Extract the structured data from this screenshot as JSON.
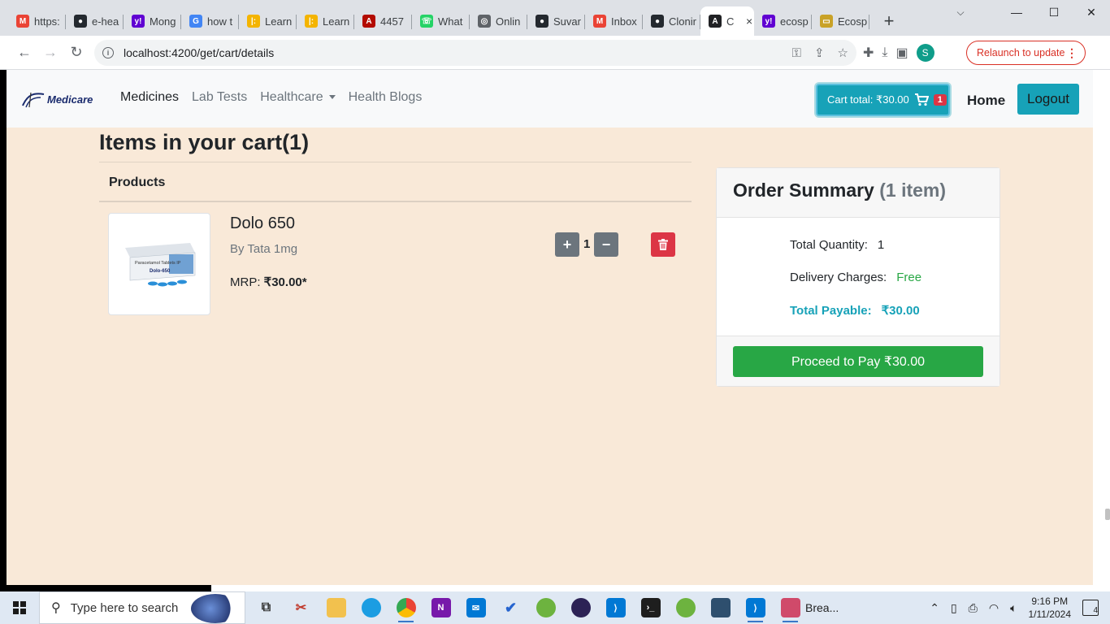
{
  "browser": {
    "tabs": [
      {
        "title": "https:",
        "icon": "gmail-icon",
        "color": "#ea4335",
        "glyph": "M"
      },
      {
        "title": "e-hea",
        "icon": "github-icon",
        "color": "#24292f",
        "glyph": "●"
      },
      {
        "title": "Mong",
        "icon": "yahoo-icon",
        "color": "#6001d2",
        "glyph": "y!"
      },
      {
        "title": "how t",
        "icon": "google-icon",
        "color": "#4285f4",
        "glyph": "G"
      },
      {
        "title": "Learn",
        "icon": "chart-bars-icon",
        "color": "#f4b400",
        "glyph": "|:"
      },
      {
        "title": "Learn",
        "icon": "chart-bars-icon",
        "color": "#f4b400",
        "glyph": "|:"
      },
      {
        "title": "4457",
        "icon": "pdf-icon",
        "color": "#b30b00",
        "glyph": "A"
      },
      {
        "title": "What",
        "icon": "whatsapp-icon",
        "color": "#25d366",
        "glyph": "☏"
      },
      {
        "title": "Onlin",
        "icon": "globe-icon",
        "color": "#5f6368",
        "glyph": "◎"
      },
      {
        "title": "Suvar",
        "icon": "github-icon",
        "color": "#24292f",
        "glyph": "●"
      },
      {
        "title": "Inbox",
        "icon": "gmail-icon",
        "color": "#ea4335",
        "glyph": "M"
      },
      {
        "title": "Clonir",
        "icon": "github-icon",
        "color": "#24292f",
        "glyph": "●"
      },
      {
        "title": "C",
        "icon": "angular-icon",
        "color": "#202124",
        "glyph": "A",
        "active": true
      },
      {
        "title": "ecosp",
        "icon": "yahoo-icon",
        "color": "#6001d2",
        "glyph": "y!"
      },
      {
        "title": "Ecosp",
        "icon": "imdb-icon",
        "color": "#c9a227",
        "glyph": "▭"
      }
    ],
    "new_tab": "+",
    "tab_close": "×",
    "url": "localhost:4200/get/cart/details",
    "profile_initial": "S",
    "relaunch_label": "Relaunch to update"
  },
  "navbar": {
    "brand": "Medicare",
    "links": [
      {
        "label": "Medicines",
        "active": true
      },
      {
        "label": "Lab Tests",
        "active": false
      },
      {
        "label": "Healthcare",
        "active": false,
        "dropdown": true
      },
      {
        "label": "Health Blogs",
        "active": false
      }
    ],
    "cart_label": "Cart total: ₹30.00",
    "cart_count": "1",
    "home": "Home",
    "logout": "Logout"
  },
  "cart": {
    "title": "Items in your cart(1)",
    "products_heading": "Products",
    "item": {
      "name": "Dolo 650",
      "brand": "By Tata 1mg",
      "mrp_label": "MRP:",
      "mrp_value": "₹30.00*",
      "quantity": "1",
      "package_text": "Paracetamol Tablets IP",
      "package_name": "Dolo-650"
    },
    "plus": "+",
    "minus": "−"
  },
  "summary": {
    "title": "Order Summary",
    "count": "(1 item)",
    "total_quantity_label": "Total Quantity:",
    "total_quantity_value": "1",
    "delivery_label": "Delivery Charges:",
    "delivery_value": "Free",
    "payable_label": "Total Payable:",
    "payable_value": "₹30.00",
    "pay_button": "Proceed to Pay ₹30.00"
  },
  "taskbar": {
    "search_placeholder": "Type here to search",
    "open_label": "Brea...",
    "time": "9:16 PM",
    "date": "1/11/2024",
    "notifications": "4"
  },
  "colors": {
    "page_bg": "#f9e9d8",
    "info": "#17a2b8",
    "success": "#28a745",
    "danger": "#dc3545",
    "secondary": "#6c757d"
  }
}
